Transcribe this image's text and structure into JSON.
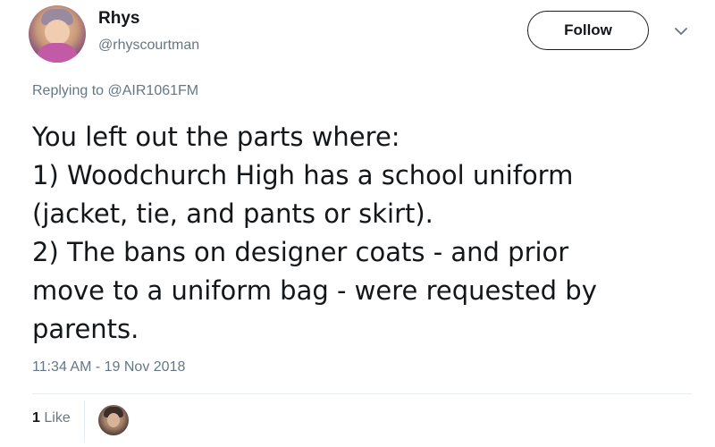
{
  "author": {
    "name": "Rhys",
    "handle": "@rhyscourtman",
    "avatar_icon": "profile-photo-avatar"
  },
  "actions": {
    "follow_label": "Follow",
    "more_icon": "chevron-down-icon"
  },
  "reply_context": {
    "prefix": "Replying to ",
    "mention": "@AIR1061FM"
  },
  "tweet": {
    "text": "You left out the parts where:\n1)  Woodchurch High has a school uniform\n(jacket, tie, and pants or skirt).\n2)  The bans on designer coats - and prior\nmove to a uniform bag - were requested by\nparents.",
    "timestamp": "11:34 AM - 19 Nov 2018"
  },
  "engagement": {
    "like_count": "1",
    "like_label": "Like",
    "liker_avatar_icon": "liker-profile-avatar"
  },
  "colors": {
    "text_primary": "#14171a",
    "text_secondary": "#657786",
    "divider": "#e6ecf0"
  }
}
